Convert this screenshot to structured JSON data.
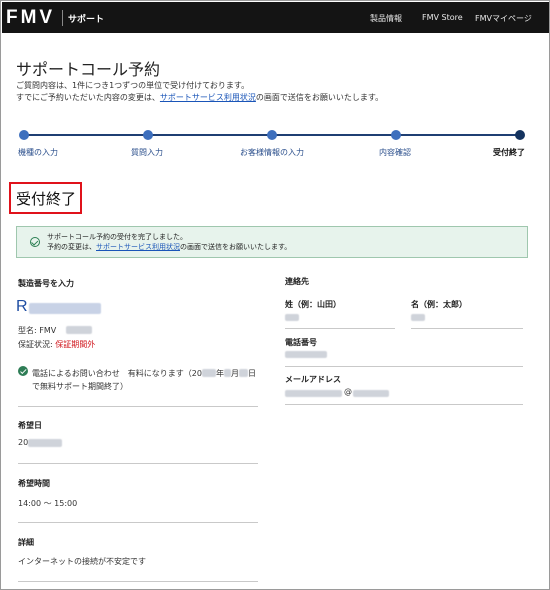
{
  "header": {
    "logo": "FMV",
    "logo_sub": "サポート",
    "nav": [
      "製品情報",
      "FMV Store",
      "FMVマイページ"
    ]
  },
  "page": {
    "title": "サポートコール予約",
    "intro_line1": "ご質問内容は、1件につき1つずつの単位で受け付けております。",
    "intro_line2_pre": "すでにご予約いただいた内容の変更は、",
    "intro_line2_link": "サポートサービス利用状況",
    "intro_line2_post": "の画面で送信をお願いいたします。"
  },
  "stepper": {
    "steps": [
      "機種の入力",
      "質問入力",
      "お客様情報の入力",
      "内容確認",
      "受付終了"
    ],
    "current_index": 4
  },
  "completion": {
    "heading": "受付終了",
    "banner_line1": "サポートコール予約の受付を完了しました。",
    "banner_line2_pre": "予約の変更は、",
    "banner_line2_link": "サポートサービス利用状況",
    "banner_line2_post": "の画面で送信をお願いいたします。"
  },
  "product": {
    "serial_label": "製造番号を入力",
    "serial_prefix": "R",
    "model_prefix": "型名: FMV",
    "warranty_label": "保証状況: ",
    "warranty_value": "保証期間外",
    "phone_notice_line1_a": "電話によるお問い合わせ　有料になります（20",
    "phone_notice_line1_b": "年",
    "phone_notice_line1_c": "月",
    "phone_notice_line1_d": "日",
    "phone_notice_line2": "で無料サポート期間終了）"
  },
  "reservation": {
    "date_label": "希望日",
    "date_prefix": "20",
    "time_label": "希望時間",
    "time_value": "14:00 ～ 15:00",
    "detail_label": "詳細",
    "detail_value": "インターネットの接続が不安定です"
  },
  "contact": {
    "heading": "連絡先",
    "last_name_label": "姓（例：山田）",
    "first_name_label": "名（例：太郎）",
    "phone_label": "電話番号",
    "email_label": "メールアドレス",
    "email_at": "@"
  },
  "colors": {
    "accent": "#1f3f73",
    "link": "#1a55b8",
    "highlight_box": "#e0121b",
    "banner_bg": "#e7f3ec",
    "warning": "#d0141b"
  }
}
